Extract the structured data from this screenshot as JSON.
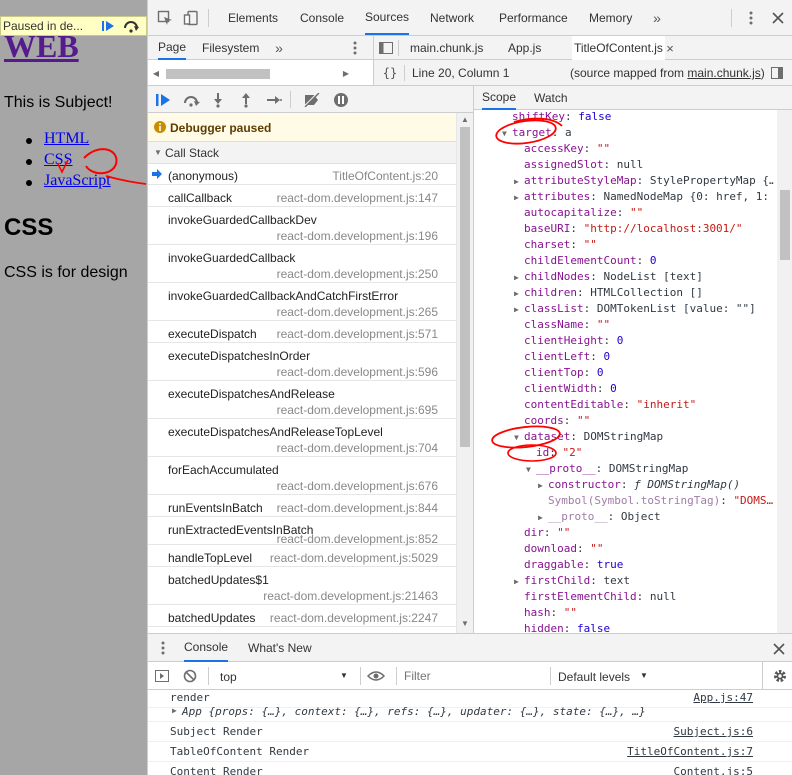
{
  "page": {
    "paused_text": "Paused in de...",
    "title": "WEB",
    "subject": "This is Subject!",
    "links": [
      "HTML",
      "CSS",
      "JavaScript"
    ],
    "heading": "CSS",
    "description": "CSS is for design"
  },
  "devtools": {
    "main_tabs": [
      "Elements",
      "Console",
      "Sources",
      "Network",
      "Performance",
      "Memory"
    ],
    "selected_tab": "Sources",
    "navigator_tabs": [
      "Page",
      "Filesystem"
    ],
    "editor_tabs": [
      "main.chunk.js",
      "App.js",
      "TitleOfContent.js"
    ],
    "status": {
      "position": "Line 20, Column 1",
      "source_mapped_prefix": "(source mapped from ",
      "source_mapped_file": "main.chunk.js",
      "source_mapped_suffix": ")"
    },
    "debugger_paused": "Debugger paused",
    "call_stack_title": "Call Stack",
    "call_stack": [
      {
        "fn": "(anonymous)",
        "loc": "TitleOfContent.js:20"
      },
      {
        "fn": "callCallback",
        "loc": "react-dom.development.js:147"
      },
      {
        "fn": "invokeGuardedCallbackDev",
        "loc": "react-dom.development.js:196"
      },
      {
        "fn": "invokeGuardedCallback",
        "loc": "react-dom.development.js:250"
      },
      {
        "fn": "invokeGuardedCallbackAndCatchFirstError",
        "loc": "react-dom.development.js:265"
      },
      {
        "fn": "executeDispatch",
        "loc": "react-dom.development.js:571"
      },
      {
        "fn": "executeDispatchesInOrder",
        "loc": "react-dom.development.js:596"
      },
      {
        "fn": "executeDispatchesAndRelease",
        "loc": "react-dom.development.js:695"
      },
      {
        "fn": "executeDispatchesAndReleaseTopLevel",
        "loc": "react-dom.development.js:704"
      },
      {
        "fn": "forEachAccumulated",
        "loc": "react-dom.development.js:676"
      },
      {
        "fn": "runEventsInBatch",
        "loc": "react-dom.development.js:844"
      },
      {
        "fn": "runExtractedEventsInBatch",
        "loc": "react-dom.development.js:852"
      },
      {
        "fn": "handleTopLevel",
        "loc": "react-dom.development.js:5029"
      },
      {
        "fn": "batchedUpdates$1",
        "loc": "react-dom.development.js:21463"
      },
      {
        "fn": "batchedUpdates",
        "loc": "react-dom.development.js:2247"
      }
    ],
    "scope_tabs": [
      "Scope",
      "Watch"
    ],
    "scope": [
      {
        "indent": 0,
        "tri": "",
        "key": "shiftKey",
        "val": "false",
        "type": "n"
      },
      {
        "indent": 0,
        "tri": "down",
        "key": "target",
        "val": "a",
        "type": "o"
      },
      {
        "indent": 1,
        "tri": "",
        "key": "accessKey",
        "val": "\"\"",
        "type": "s"
      },
      {
        "indent": 1,
        "tri": "",
        "key": "assignedSlot",
        "val": "null",
        "type": "o"
      },
      {
        "indent": 1,
        "tri": "right",
        "key": "attributeStyleMap",
        "val": "StylePropertyMap {…",
        "type": "o"
      },
      {
        "indent": 1,
        "tri": "right",
        "key": "attributes",
        "val": "NamedNodeMap {0: href, 1: …",
        "type": "o"
      },
      {
        "indent": 1,
        "tri": "",
        "key": "autocapitalize",
        "val": "\"\"",
        "type": "s"
      },
      {
        "indent": 1,
        "tri": "",
        "key": "baseURI",
        "val": "\"http://localhost:3001/\"",
        "type": "s"
      },
      {
        "indent": 1,
        "tri": "",
        "key": "charset",
        "val": "\"\"",
        "type": "s"
      },
      {
        "indent": 1,
        "tri": "",
        "key": "childElementCount",
        "val": "0",
        "type": "n"
      },
      {
        "indent": 1,
        "tri": "right",
        "key": "childNodes",
        "val": "NodeList [text]",
        "type": "o"
      },
      {
        "indent": 1,
        "tri": "right",
        "key": "children",
        "val": "HTMLCollection []",
        "type": "o"
      },
      {
        "indent": 1,
        "tri": "right",
        "key": "classList",
        "val": "DOMTokenList [value: \"\"]",
        "type": "o"
      },
      {
        "indent": 1,
        "tri": "",
        "key": "className",
        "val": "\"\"",
        "type": "s"
      },
      {
        "indent": 1,
        "tri": "",
        "key": "clientHeight",
        "val": "0",
        "type": "n"
      },
      {
        "indent": 1,
        "tri": "",
        "key": "clientLeft",
        "val": "0",
        "type": "n"
      },
      {
        "indent": 1,
        "tri": "",
        "key": "clientTop",
        "val": "0",
        "type": "n"
      },
      {
        "indent": 1,
        "tri": "",
        "key": "clientWidth",
        "val": "0",
        "type": "n"
      },
      {
        "indent": 1,
        "tri": "",
        "key": "contentEditable",
        "val": "\"inherit\"",
        "type": "s"
      },
      {
        "indent": 1,
        "tri": "",
        "key": "coords",
        "val": "\"\"",
        "type": "s"
      },
      {
        "indent": 1,
        "tri": "down",
        "key": "dataset",
        "val": "DOMStringMap",
        "type": "o"
      },
      {
        "indent": 2,
        "tri": "",
        "key": "id",
        "val": "\"2\"",
        "type": "s"
      },
      {
        "indent": 2,
        "tri": "down",
        "key": "__proto__",
        "val": "DOMStringMap",
        "type": "o"
      },
      {
        "indent": 3,
        "tri": "right",
        "key": "constructor",
        "val": "ƒ DOMStringMap()",
        "type": "f"
      },
      {
        "indent": 3,
        "tri": "",
        "key": "Symbol(Symbol.toStringTag)",
        "val": "\"DOMS…",
        "type": "s",
        "dim": true
      },
      {
        "indent": 3,
        "tri": "right",
        "key": "__proto__",
        "val": "Object",
        "type": "o",
        "dim": true
      },
      {
        "indent": 1,
        "tri": "",
        "key": "dir",
        "val": "\"\"",
        "type": "s"
      },
      {
        "indent": 1,
        "tri": "",
        "key": "download",
        "val": "\"\"",
        "type": "s"
      },
      {
        "indent": 1,
        "tri": "",
        "key": "draggable",
        "val": "true",
        "type": "n"
      },
      {
        "indent": 1,
        "tri": "right",
        "key": "firstChild",
        "val": "text",
        "type": "o"
      },
      {
        "indent": 1,
        "tri": "",
        "key": "firstElementChild",
        "val": "null",
        "type": "o"
      },
      {
        "indent": 1,
        "tri": "",
        "key": "hash",
        "val": "\"\"",
        "type": "s"
      },
      {
        "indent": 1,
        "tri": "",
        "key": "hidden",
        "val": "false",
        "type": "n"
      }
    ],
    "drawer_tabs": [
      "Console",
      "What's New"
    ],
    "console_context": "top",
    "filter_placeholder": "Filter",
    "default_levels": "Default levels",
    "console": [
      {
        "text": "render",
        "src": "App.js:47"
      },
      {
        "text": "App {props: {…}, context: {…}, refs: {…}, updater: {…}, state: {…}, …}",
        "src": "",
        "expand": true
      },
      {
        "text": "Subject Render",
        "src": "Subject.js:6"
      },
      {
        "text": "TableOfContent Render",
        "src": "TitleOfContent.js:7"
      },
      {
        "text": "Content Render",
        "src": "Content.js:5"
      }
    ],
    "annotation_color": "#ff0000",
    "accent": "#1a73e8"
  }
}
